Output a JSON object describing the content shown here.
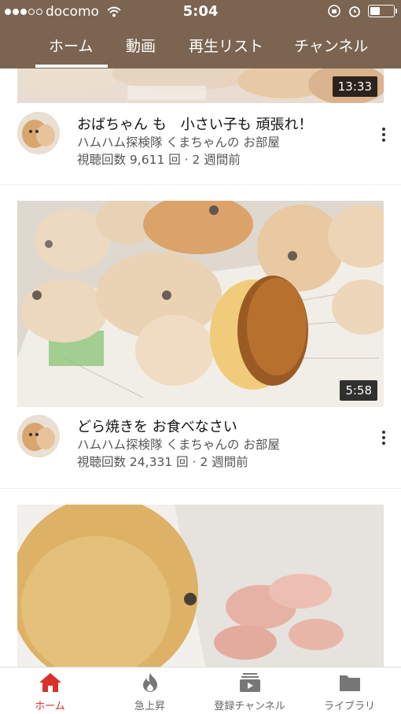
{
  "status_bar": {
    "carrier": "docomo",
    "time": "5:04",
    "battery_level": 0.45
  },
  "tabs": [
    {
      "label": "ホーム",
      "active": true
    },
    {
      "label": "動画",
      "active": false
    },
    {
      "label": "再生リスト",
      "active": false
    },
    {
      "label": "チャンネル",
      "active": false
    }
  ],
  "videos": [
    {
      "duration": "13:33",
      "title": "おばちゃん も　小さい子も 頑張れ！",
      "channel": "ハムハム探検隊 くまちゃんの お部屋",
      "stats": "視聴回数 9,611 回 · 2 週間前"
    },
    {
      "duration": "5:58",
      "title": "どら焼きを お食べなさい",
      "channel": "ハムハム探検隊 くまちゃんの お部屋",
      "stats": "視聴回数 24,331 回 · 2 週間前"
    },
    {
      "duration": "",
      "title": "",
      "channel": "",
      "stats": ""
    }
  ],
  "bottom_nav": [
    {
      "label": "ホーム",
      "icon": "home-icon",
      "active": true
    },
    {
      "label": "急上昇",
      "icon": "flame-icon",
      "active": false
    },
    {
      "label": "登録チャンネル",
      "icon": "subscriptions-icon",
      "active": false
    },
    {
      "label": "ライブラリ",
      "icon": "folder-icon",
      "active": false
    }
  ],
  "colors": {
    "header": "#7b6450",
    "accent": "#d9312a"
  }
}
